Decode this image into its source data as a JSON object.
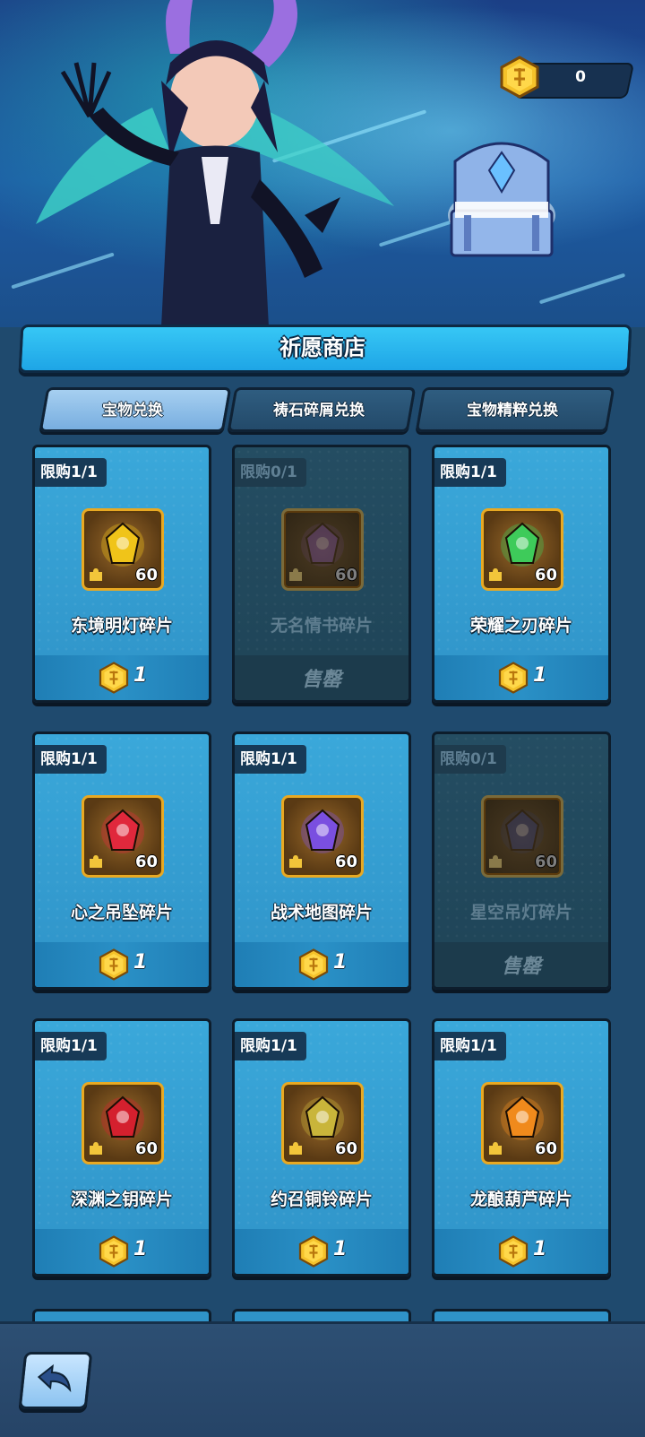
{
  "currency": {
    "value": "0"
  },
  "title": "祈愿商店",
  "tabs": [
    {
      "label": "宝物兑换",
      "active": true
    },
    {
      "label": "祷石碎屑兑换",
      "active": false
    },
    {
      "label": "宝物精粹兑换",
      "active": false
    }
  ],
  "items": [
    {
      "limit": "限购1/1",
      "name": "东境明灯碎片",
      "qty": "60",
      "price": "1",
      "sold_out": false,
      "icon": "golden-lantern-icon",
      "color": "#f0c419"
    },
    {
      "limit": "限购0/1",
      "name": "无名情书碎片",
      "qty": "60",
      "price": "",
      "sold_out": true,
      "sold_label": "售罄",
      "icon": "love-letter-icon",
      "color": "#7b4fb5"
    },
    {
      "limit": "限购1/1",
      "name": "荣耀之刃碎片",
      "qty": "60",
      "price": "1",
      "sold_out": false,
      "icon": "green-blade-icon",
      "color": "#3ecb5a"
    },
    {
      "limit": "限购1/1",
      "name": "心之吊坠碎片",
      "qty": "60",
      "price": "1",
      "sold_out": false,
      "icon": "heart-pendant-icon",
      "color": "#e0283c"
    },
    {
      "limit": "限购1/1",
      "name": "战术地图碎片",
      "qty": "60",
      "price": "1",
      "sold_out": false,
      "icon": "tactical-map-icon",
      "color": "#7a4fe0"
    },
    {
      "limit": "限购0/1",
      "name": "星空吊灯碎片",
      "qty": "60",
      "price": "",
      "sold_out": true,
      "sold_label": "售罄",
      "icon": "star-chandelier-icon",
      "color": "#2b3b8a"
    },
    {
      "limit": "限购1/1",
      "name": "深渊之钥碎片",
      "qty": "60",
      "price": "1",
      "sold_out": false,
      "icon": "abyss-key-icon",
      "color": "#d4202e"
    },
    {
      "limit": "限购1/1",
      "name": "约召铜铃碎片",
      "qty": "60",
      "price": "1",
      "sold_out": false,
      "icon": "bronze-bell-icon",
      "color": "#c9b53a"
    },
    {
      "limit": "限购1/1",
      "name": "龙酿葫芦碎片",
      "qty": "60",
      "price": "1",
      "sold_out": false,
      "icon": "dragon-gourd-icon",
      "color": "#f08a1c"
    }
  ]
}
